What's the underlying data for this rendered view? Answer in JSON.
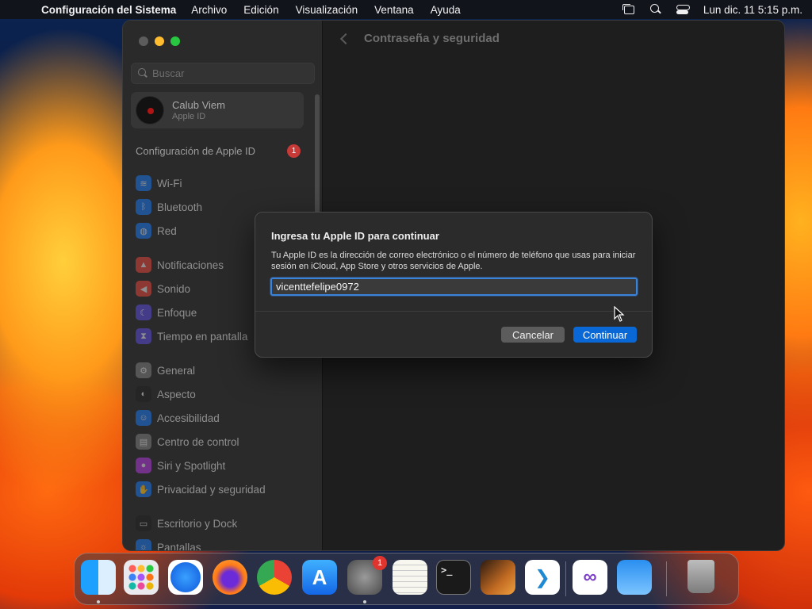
{
  "menubar": {
    "apple_glyph": "",
    "app_name": "Configuración del Sistema",
    "menus": [
      "Archivo",
      "Edición",
      "Visualización",
      "Ventana",
      "Ayuda"
    ],
    "clock": "Lun dic. 11  5:15 p.m."
  },
  "window": {
    "title": "Contraseña y seguridad",
    "search_placeholder": "Buscar",
    "account": {
      "name": "Calub Viem",
      "subtitle": "Apple ID"
    },
    "apple_id_row": {
      "label": "Configuración de Apple ID",
      "badge": "1"
    },
    "group1": [
      {
        "label": "Wi-Fi",
        "icon": "wifi-icon",
        "color": "#1a73e8",
        "glyph": "≋"
      },
      {
        "label": "Bluetooth",
        "icon": "bluetooth-icon",
        "color": "#1a73e8",
        "glyph": "ᛒ"
      },
      {
        "label": "Red",
        "icon": "globe-icon",
        "color": "#1a73e8",
        "glyph": "◍"
      }
    ],
    "group2": [
      {
        "label": "Notificaciones",
        "icon": "bell-icon",
        "color": "#e0443b",
        "glyph": "▲"
      },
      {
        "label": "Sonido",
        "icon": "speaker-icon",
        "color": "#e0443b",
        "glyph": "◀"
      },
      {
        "label": "Enfoque",
        "icon": "moon-icon",
        "color": "#5b4bd6",
        "glyph": "☾"
      },
      {
        "label": "Tiempo en pantalla",
        "icon": "hourglass-icon",
        "color": "#5b4bd6",
        "glyph": "⧗"
      }
    ],
    "group3": [
      {
        "label": "General",
        "icon": "gear-icon",
        "color": "#7b7b7b",
        "glyph": "⚙"
      },
      {
        "label": "Aspecto",
        "icon": "appearance-icon",
        "color": "#222222",
        "glyph": "◐"
      },
      {
        "label": "Accesibilidad",
        "icon": "accessibility-icon",
        "color": "#1a73e8",
        "glyph": "☺"
      },
      {
        "label": "Centro de control",
        "icon": "control-center-icon",
        "color": "#7b7b7b",
        "glyph": "▤"
      },
      {
        "label": "Siri y Spotlight",
        "icon": "siri-icon",
        "color": "#b03ad8",
        "glyph": "●"
      },
      {
        "label": "Privacidad y seguridad",
        "icon": "hand-icon",
        "color": "#1a73e8",
        "glyph": "✋"
      }
    ],
    "group4": [
      {
        "label": "Escritorio y Dock",
        "icon": "dock-icon",
        "color": "#222222",
        "glyph": "▭"
      },
      {
        "label": "Pantallas",
        "icon": "display-icon",
        "color": "#1a73e8",
        "glyph": "☼"
      }
    ]
  },
  "dialog": {
    "title": "Ingresa tu Apple ID para continuar",
    "text": "Tu Apple ID es la dirección de correo electrónico o el número de teléfono que usas para iniciar sesión en iCloud, App Store y otros servicios de Apple.",
    "input_value": "vicenttefelipe0972",
    "cancel_label": "Cancelar",
    "continue_label": "Continuar"
  },
  "dock": {
    "apps": [
      {
        "name": "Finder",
        "icon": "finder-icon",
        "running": true
      },
      {
        "name": "Launchpad",
        "icon": "launchpad-icon",
        "running": false
      },
      {
        "name": "Safari",
        "icon": "safari-icon",
        "running": false
      },
      {
        "name": "Firefox",
        "icon": "firefox-icon",
        "running": false
      },
      {
        "name": "Chrome",
        "icon": "chrome-icon",
        "running": false
      },
      {
        "name": "App Store",
        "icon": "app-store-icon",
        "running": false
      },
      {
        "name": "Configuración del Sistema",
        "icon": "system-settings-icon",
        "running": true,
        "badge": "1"
      },
      {
        "name": "TextEdit",
        "icon": "textedit-icon",
        "running": false
      },
      {
        "name": "Terminal",
        "icon": "terminal-icon",
        "running": false,
        "glyph": ">_"
      },
      {
        "name": "GarageBand",
        "icon": "guitar-icon",
        "running": false
      },
      {
        "name": "Visual Studio Code",
        "icon": "vscode-icon",
        "running": false
      },
      {
        "name": "Visual Studio",
        "icon": "visual-studio-icon",
        "running": false
      },
      {
        "name": "Weather",
        "icon": "weather-icon",
        "running": false
      },
      {
        "name": "Papelera",
        "icon": "trash-icon",
        "running": false
      }
    ]
  }
}
